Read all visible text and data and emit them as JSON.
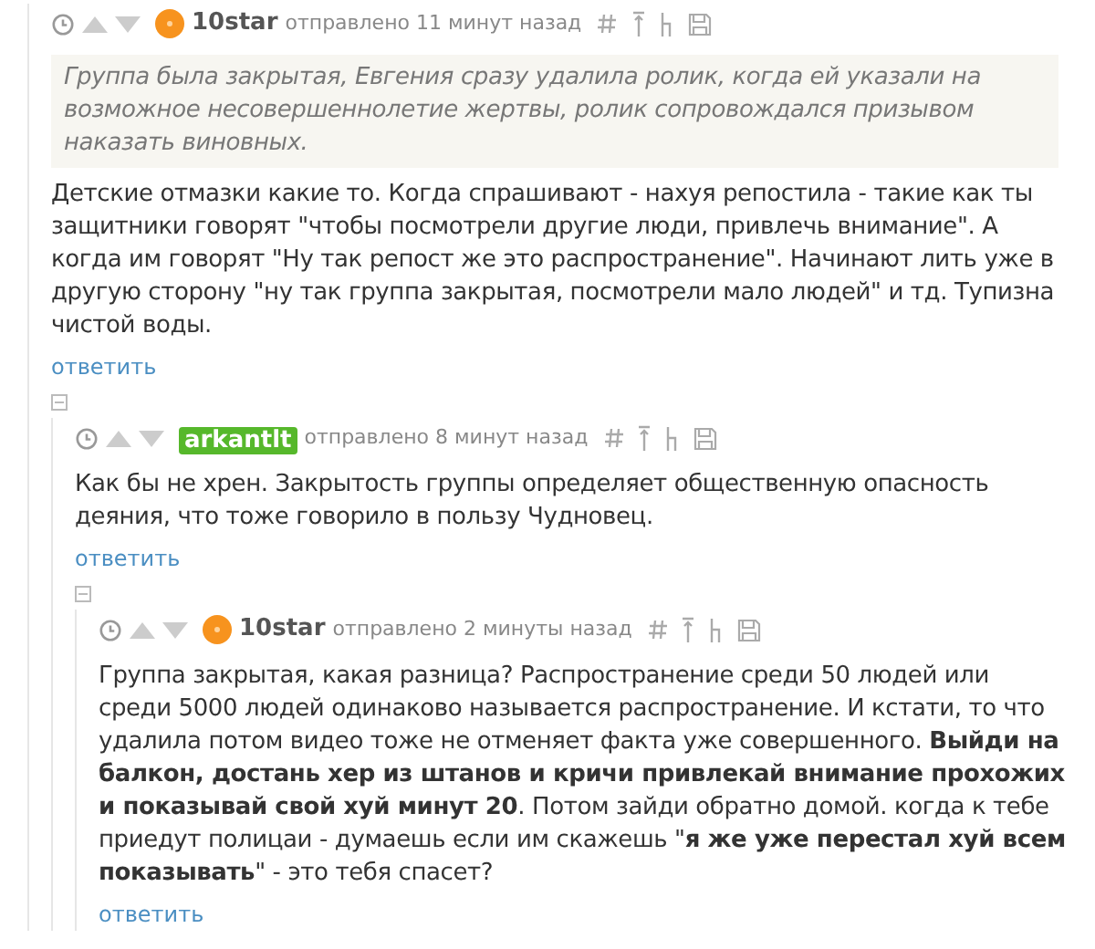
{
  "comments": [
    {
      "author": {
        "name": "10star",
        "kind": "avatar"
      },
      "time": "отправлено 11 минут назад",
      "quote": "Группа была закрытая, Евгения сразу удалила ролик, когда ей указали на возможное несовершеннолетие жертвы, ролик сопровождался призывом наказать виновных.",
      "body": "Детские отмазки какие то. Когда спрашивают - нахуя репостила - такие как ты защитники говорят \"чтобы посмотрели другие люди, привлечь внимание\". А когда им говорят \"Ну так репост же это распространение\". Начинают лить уже в другую сторону \"ну так группа закрытая, посмотрели мало людей\" и тд. Тупизна чистой воды.",
      "reply": "ответить",
      "children": [
        {
          "expanded": true,
          "author": {
            "name": "arkantlt",
            "kind": "badge"
          },
          "time": "отправлено 8 минут назад",
          "body": "Как бы не хрен. Закрытость группы определяет общественную опасность деяния, что тоже говорило в пользу Чудновец.",
          "reply": "ответить",
          "children": [
            {
              "expanded": true,
              "author": {
                "name": "10star",
                "kind": "avatar"
              },
              "time": "отправлено 2 минуты назад",
              "body": "Группа закрытая, какая разница? Распространение среди 50 людей или среди 5000 людей одинаково называется распространение. И кстати, то что удалила потом видео тоже не отменяет факта уже совершенного. **Выйди на балкон, достань хер из штанов и кричи привлекай внимание прохожих и показывай свой хуй минут 20**. Потом зайди обратно домой. когда к тебе приедут полицаи - думаешь если им скажешь \"**я же уже перестал хуй всем показывать**\" - это тебя спасет?",
              "reply": "ответить"
            }
          ]
        }
      ]
    }
  ]
}
